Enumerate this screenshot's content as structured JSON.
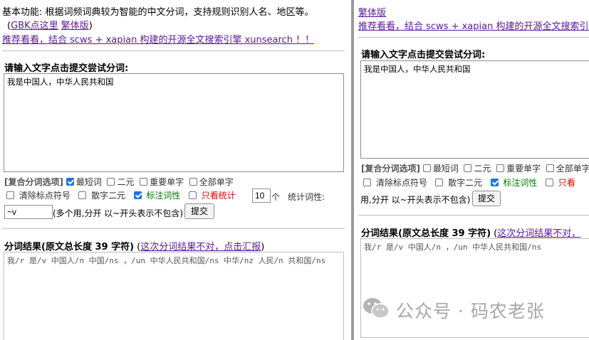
{
  "header": {
    "intro": "基本功能: 根据词频词典较为智能的中文分词，支持规则识别人名、地区等。",
    "gbk_link": "GBK点这里",
    "trad_link": "繁体版",
    "promo_link": "推荐看看，结合 scws + xapian 构建的开源全文搜索引擎 xunsearch ！！",
    "open_paren": "(",
    "close_paren": ")"
  },
  "form": {
    "input_label": "请输入文字点击提交尝试分词:",
    "input_text": "我是中国人，中华人民共和国",
    "options_label": "[复合分词选项]",
    "options": {
      "shortest": "最短词",
      "binary": "二元",
      "important_single": "重要单字",
      "all_single": "全部单字",
      "remove_punct": "清除标点符号",
      "scatter_binary": "散字二元",
      "tag_pos": "标注词性",
      "stats_only": "只看统计"
    },
    "count_value": "10",
    "count_unit": "个",
    "stat_pos_label": "统计词性:",
    "pos_filter_value": "~v",
    "pos_filter_hint": "(多个用,分开 以~开头表示不包含)",
    "submit_label": "提交"
  },
  "result": {
    "title": "分词结果(原文总长度 39 字符)",
    "report_link": "这次分词结果不对，点击汇报",
    "text": "我/r 是/v 中国人/n 中国/ns ，/un 中华人民共和国/ns 中华/nz 人民/n 共和国/ns"
  },
  "right_pane": {
    "top_link": "繁体版",
    "promo_link": "推荐看看，结合 scws + xapian 构建的开源全文搜索引擎 xunsearch",
    "input_label": "请输入文字点击提交尝试分词:",
    "input_text": "我是中国人，中华人民共和国",
    "options_label": "[复合分词选项]",
    "opt_shortest": "最短词",
    "opt_binary": "二元",
    "opt_important": "重要单字",
    "opt_all": "全部单字",
    "opt_remove_punct": "清除标点符号",
    "opt_scatter": "散字二元",
    "opt_tag": "标注词性",
    "opt_stats": "只看",
    "hint_tail": "用,分开 以~开头表示不包含)",
    "submit_label": "提交",
    "result_title": "分词结果(原文总长度 39 字符)",
    "report_link": "这次分词结果不对，",
    "result_text": "我/r 是/v 中国人/n ，/un 中华人民共和国/ns"
  },
  "watermark": {
    "text": "公众号 · 码农老张",
    "icon": "wechat-icon"
  },
  "colors": {
    "link": "#5a189a",
    "green": "#007a00",
    "red": "#e00000",
    "checkbox_on": "#1a73e8"
  }
}
